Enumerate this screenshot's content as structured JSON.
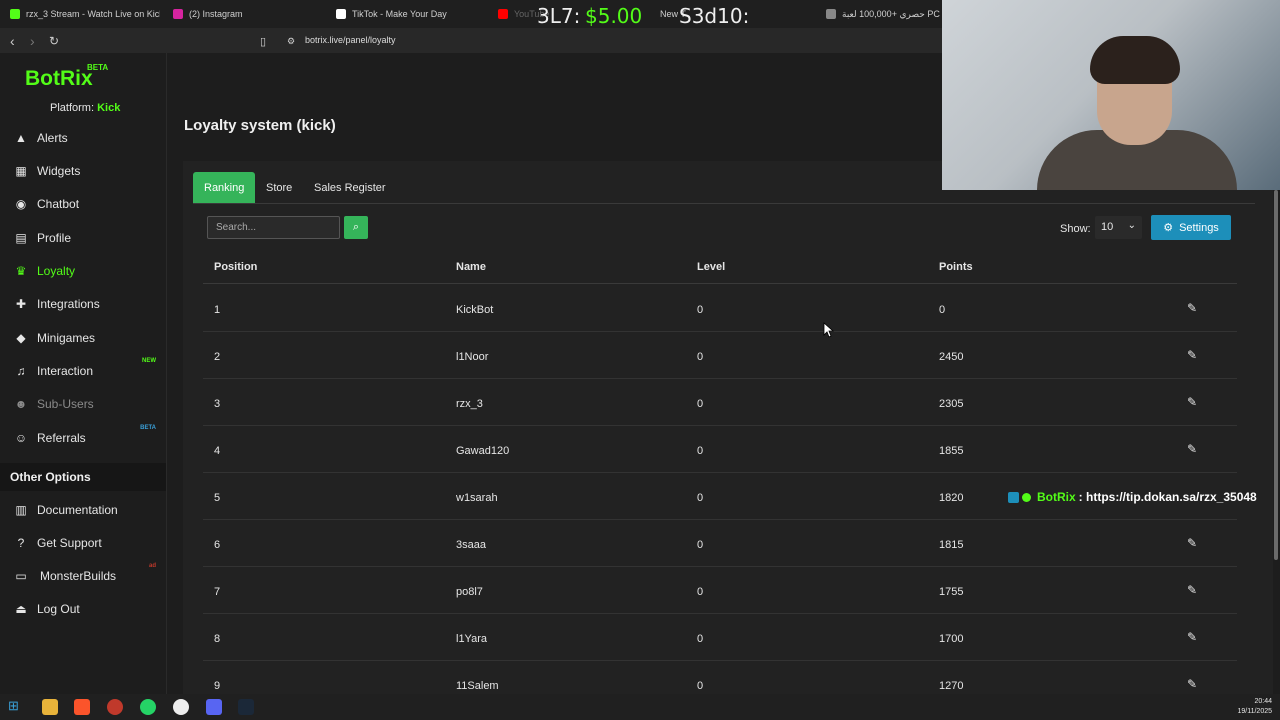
{
  "browser": {
    "tabs": [
      {
        "title": "rzx_3 Stream - Watch Live on Kick",
        "color": "#53fc18"
      },
      {
        "title": "(2) Instagram",
        "color": "#d6249f"
      },
      {
        "title": "TikTok - Make Your Day",
        "color": "#ffffff"
      },
      {
        "title": "YouTube",
        "color": "#ff0000"
      },
      {
        "title": "New T",
        "color": "#888888"
      },
      {
        "title": "حصري +100,000 لعبة PC - جاك ...",
        "color": "#888888"
      }
    ],
    "overlay_left": "3L7: ",
    "overlay_price": "$5.00",
    "overlay_right": "S3d10:",
    "url": "botrix.live/panel/loyalty"
  },
  "sidebar": {
    "logo": "BotRix",
    "logo_badge": "BETA",
    "platform_label": "Platform: ",
    "platform_value": "Kick",
    "items": [
      {
        "label": "Alerts",
        "icon": "warning-icon"
      },
      {
        "label": "Widgets",
        "icon": "widgets-icon"
      },
      {
        "label": "Chatbot",
        "icon": "robot-icon"
      },
      {
        "label": "Profile",
        "icon": "id-card-icon"
      },
      {
        "label": "Loyalty",
        "icon": "trophy-icon"
      },
      {
        "label": "Integrations",
        "icon": "puzzle-icon"
      },
      {
        "label": "Minigames",
        "icon": "gamepad-icon"
      },
      {
        "label": "Interaction",
        "icon": "music-icon",
        "badge": "NEW"
      },
      {
        "label": "Sub-Users",
        "icon": "users-icon"
      },
      {
        "label": "Referrals",
        "icon": "referral-icon",
        "badge": "BETA"
      }
    ],
    "other_options_title": "Other Options",
    "other_items": [
      {
        "label": "Documentation",
        "icon": "book-icon"
      },
      {
        "label": "Get Support",
        "icon": "question-icon"
      },
      {
        "label": "MonsterBuilds",
        "icon": "monitor-icon",
        "badge": "ad"
      },
      {
        "label": "Log Out",
        "icon": "logout-icon"
      }
    ]
  },
  "main": {
    "title": "Loyalty system (kick)",
    "tabs": [
      "Ranking",
      "Store",
      "Sales Register"
    ],
    "search_placeholder": "Search...",
    "show_label": "Show:",
    "show_value": "10",
    "settings_label": "Settings",
    "columns": [
      "Position",
      "Name",
      "Level",
      "Points"
    ],
    "rows": [
      {
        "position": "1",
        "name": "KickBot",
        "level": "0",
        "points": "0"
      },
      {
        "position": "2",
        "name": "l1Noor",
        "level": "0",
        "points": "2450"
      },
      {
        "position": "3",
        "name": "rzx_3",
        "level": "0",
        "points": "2305"
      },
      {
        "position": "4",
        "name": "Gawad120",
        "level": "0",
        "points": "1855"
      },
      {
        "position": "5",
        "name": "w1sarah",
        "level": "0",
        "points": "1820"
      },
      {
        "position": "6",
        "name": "3saaa",
        "level": "0",
        "points": "1815"
      },
      {
        "position": "7",
        "name": "po8l7",
        "level": "0",
        "points": "1755"
      },
      {
        "position": "8",
        "name": "l1Yara",
        "level": "0",
        "points": "1700"
      },
      {
        "position": "9",
        "name": "11Salem",
        "level": "0",
        "points": "1270"
      }
    ]
  },
  "chat_overlay": {
    "name": "BotRix",
    "message": ": https://tip.dokan.sa/rzx_35048"
  },
  "taskbar": {
    "time": "20:44",
    "date": "19/11/2025"
  }
}
